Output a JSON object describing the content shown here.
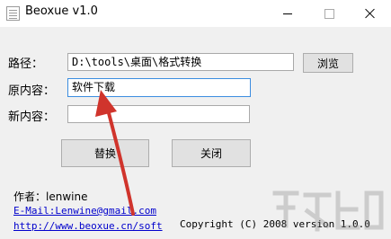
{
  "window": {
    "title": "Beoxue v1.0"
  },
  "form": {
    "path_label": "路径：",
    "path_value": "D:\\tools\\桌面\\格式转换",
    "browse_label": "浏览",
    "original_label": "原内容：",
    "original_value": "软件下载",
    "new_label": "新内容：",
    "new_value": "",
    "replace_label": "替换",
    "close_label": "关闭"
  },
  "info": {
    "author_line": "作者：lenwine",
    "email_line": "E-Mail:Lenwine@gmail.com",
    "url_line": "http://www.beoxue.cn/soft",
    "copyright_line": "Copyright (C) 2008 version 1.0.0"
  },
  "colors": {
    "annotation_arrow": "#d0342c",
    "focus_border": "#3b8de0",
    "link": "#0000cc"
  },
  "icons": {
    "app": "app-window-icon",
    "minimize": "minimize-icon",
    "maximize": "maximize-icon",
    "close": "close-icon",
    "annotation": "red-arrow-annotation"
  }
}
